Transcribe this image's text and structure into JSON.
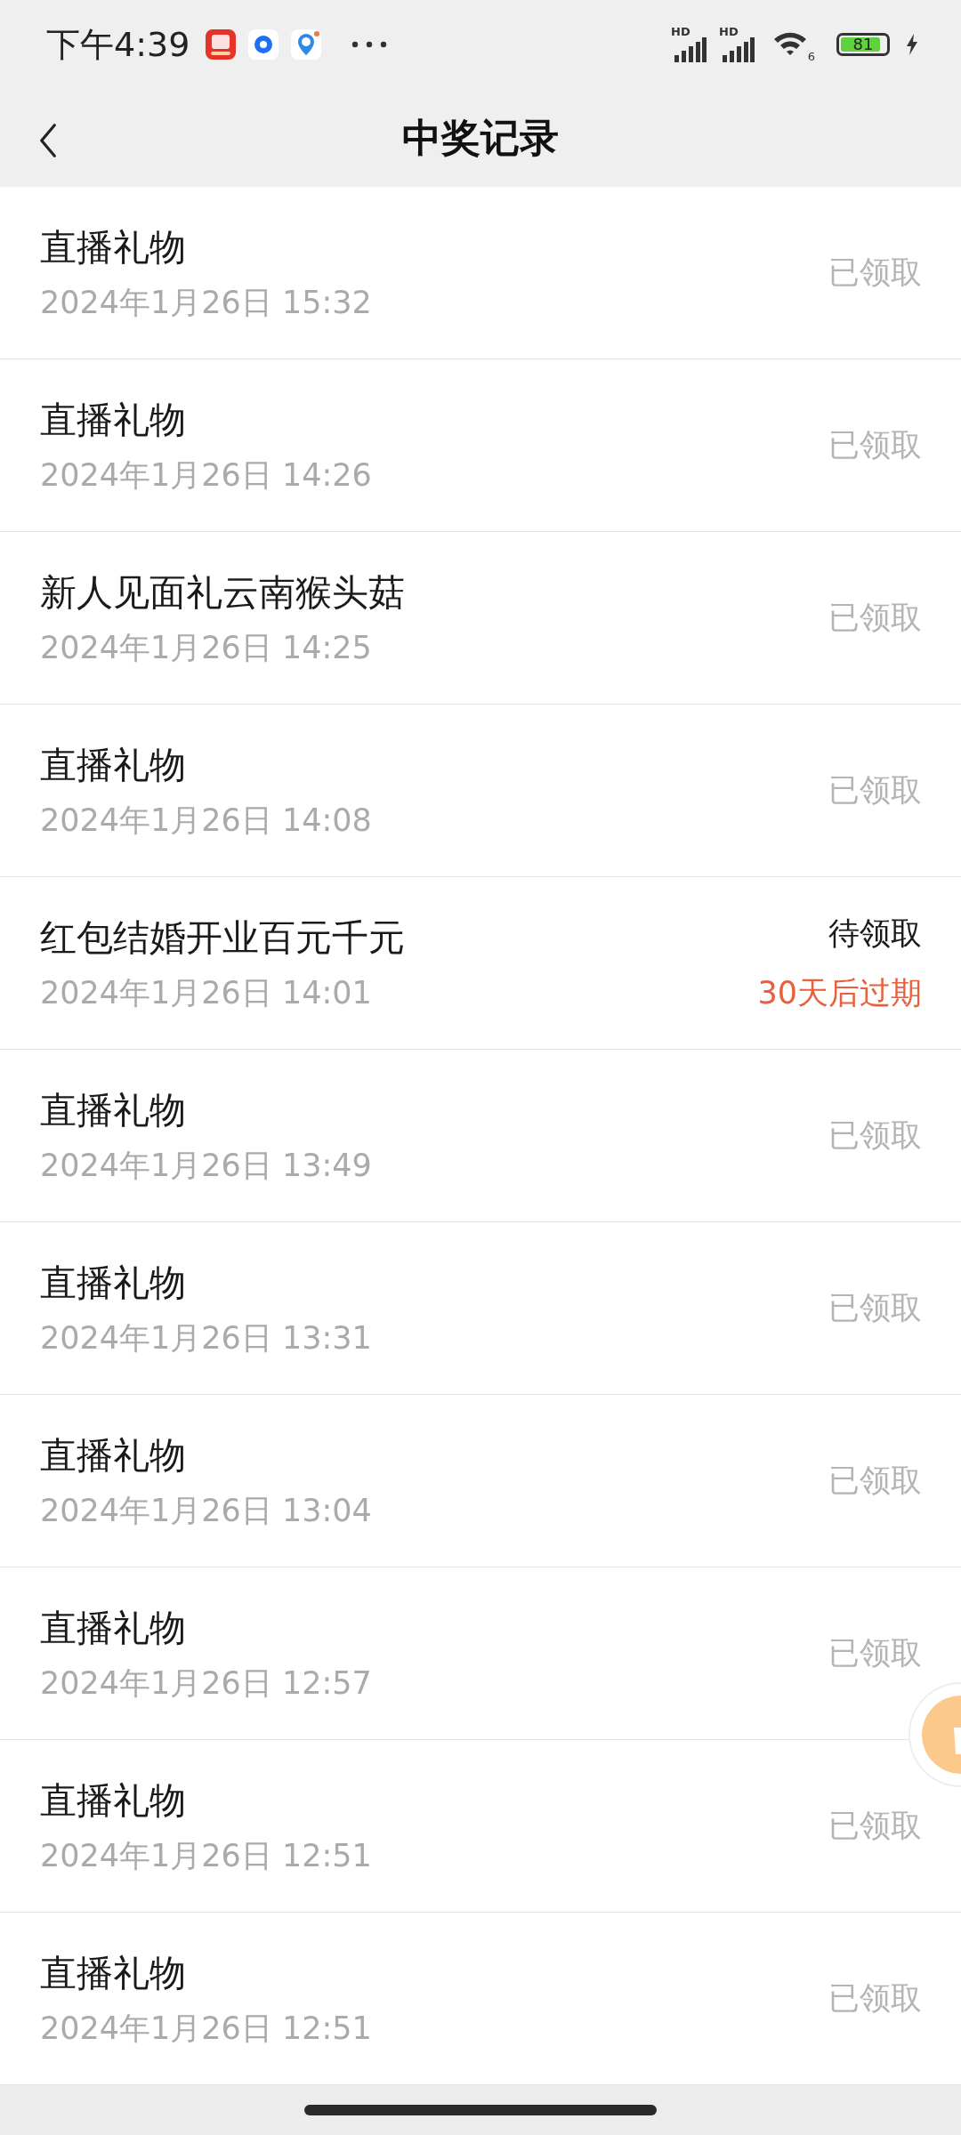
{
  "status_bar": {
    "time": "下午4:39",
    "signal_labels": [
      "HD",
      "HD"
    ],
    "wifi_label": "6",
    "battery": "81"
  },
  "header": {
    "title": "中奖记录"
  },
  "records": [
    {
      "name": "直播礼物",
      "date": "2024年1月26日 15:32",
      "kind": "claimed",
      "status": "已领取"
    },
    {
      "name": "直播礼物",
      "date": "2024年1月26日 14:26",
      "kind": "claimed",
      "status": "已领取"
    },
    {
      "name": "新人见面礼云南猴头菇",
      "date": "2024年1月26日 14:25",
      "kind": "claimed",
      "status": "已领取"
    },
    {
      "name": "直播礼物",
      "date": "2024年1月26日 14:08",
      "kind": "claimed",
      "status": "已领取"
    },
    {
      "name": "红包结婚开业百元千元",
      "date": "2024年1月26日 14:01",
      "kind": "pending",
      "status": "待领取",
      "expiry": "30天后过期"
    },
    {
      "name": "直播礼物",
      "date": "2024年1月26日 13:49",
      "kind": "claimed",
      "status": "已领取"
    },
    {
      "name": "直播礼物",
      "date": "2024年1月26日 13:31",
      "kind": "claimed",
      "status": "已领取"
    },
    {
      "name": "直播礼物",
      "date": "2024年1月26日 13:04",
      "kind": "claimed",
      "status": "已领取"
    },
    {
      "name": "直播礼物",
      "date": "2024年1月26日 12:57",
      "kind": "claimed",
      "status": "已领取"
    },
    {
      "name": "直播礼物",
      "date": "2024年1月26日 12:51",
      "kind": "claimed",
      "status": "已领取"
    },
    {
      "name": "直播礼物",
      "date": "2024年1月26日 12:51",
      "kind": "claimed",
      "status": "已领取"
    }
  ]
}
